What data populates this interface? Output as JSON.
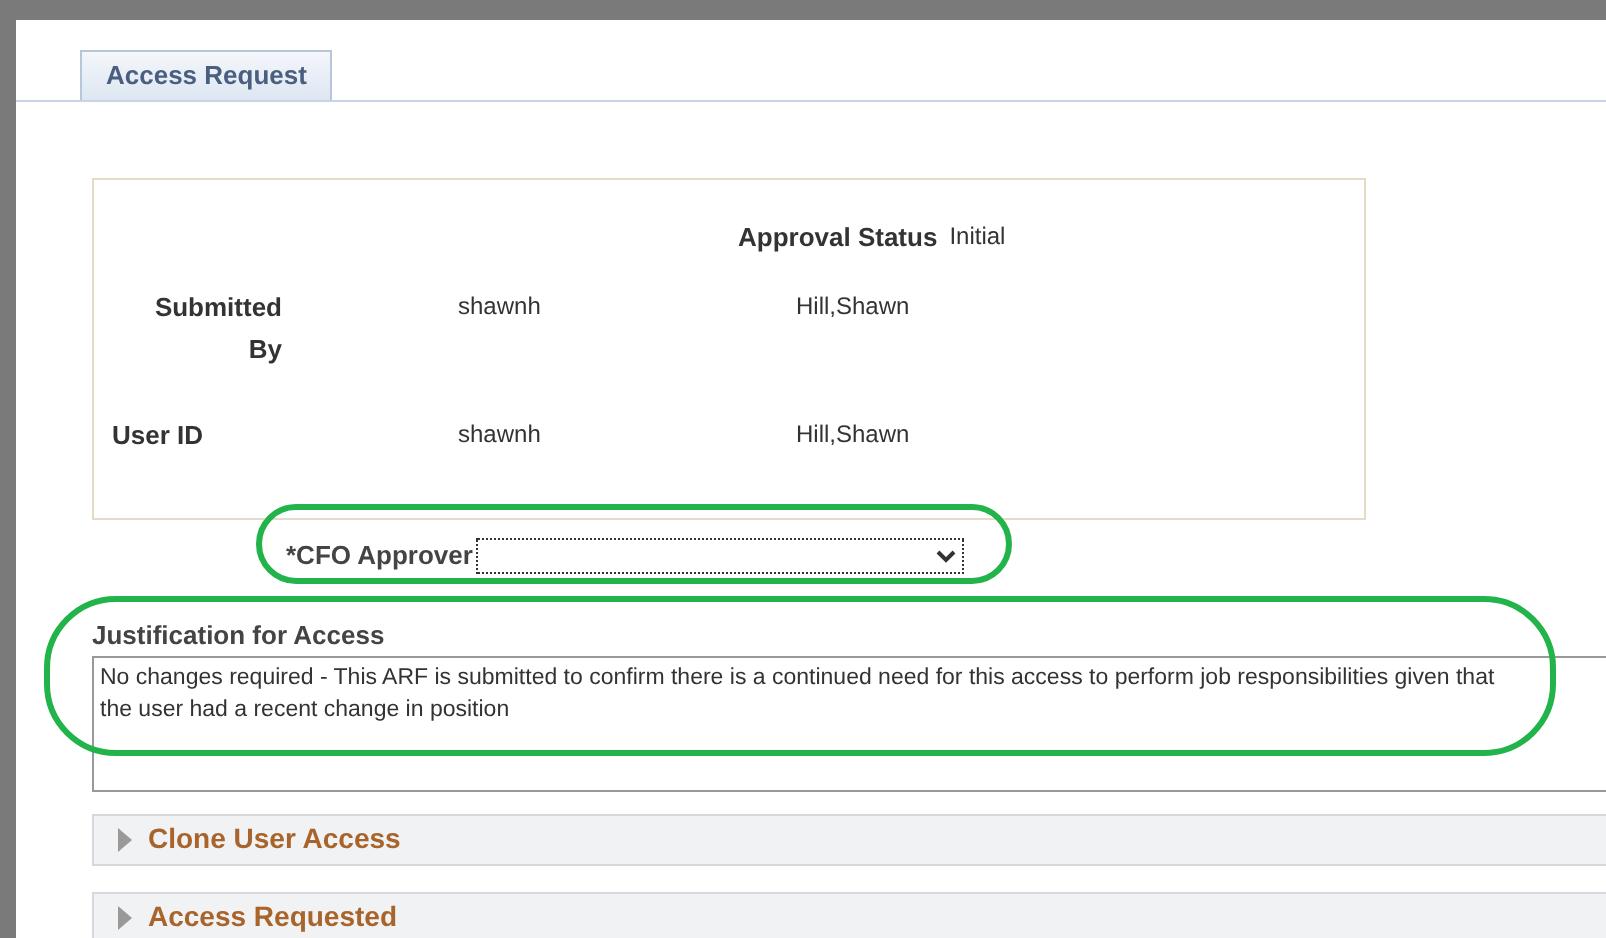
{
  "tabs": [
    {
      "label": "Access Request",
      "selected": true
    }
  ],
  "summary": {
    "approval_status_label": "Approval Status",
    "approval_status": "Initial",
    "rows": [
      {
        "label": "Submitted By",
        "user_id": "shawnh",
        "name": "Hill,Shawn"
      },
      {
        "label": "User ID",
        "user_id": "shawnh",
        "name": "Hill,Shawn"
      }
    ]
  },
  "cfo_approver": {
    "label": "*CFO Approver"
  },
  "justification": {
    "label": "Justification for Access",
    "value": "No changes required - This ARF is submitted to confirm there is a continued need for this access to perform job responsibilities given that the user had a recent change in position"
  },
  "sections": [
    {
      "title": "Clone User Access",
      "expanded": false
    },
    {
      "title": "Access Requested",
      "expanded": false
    }
  ]
}
